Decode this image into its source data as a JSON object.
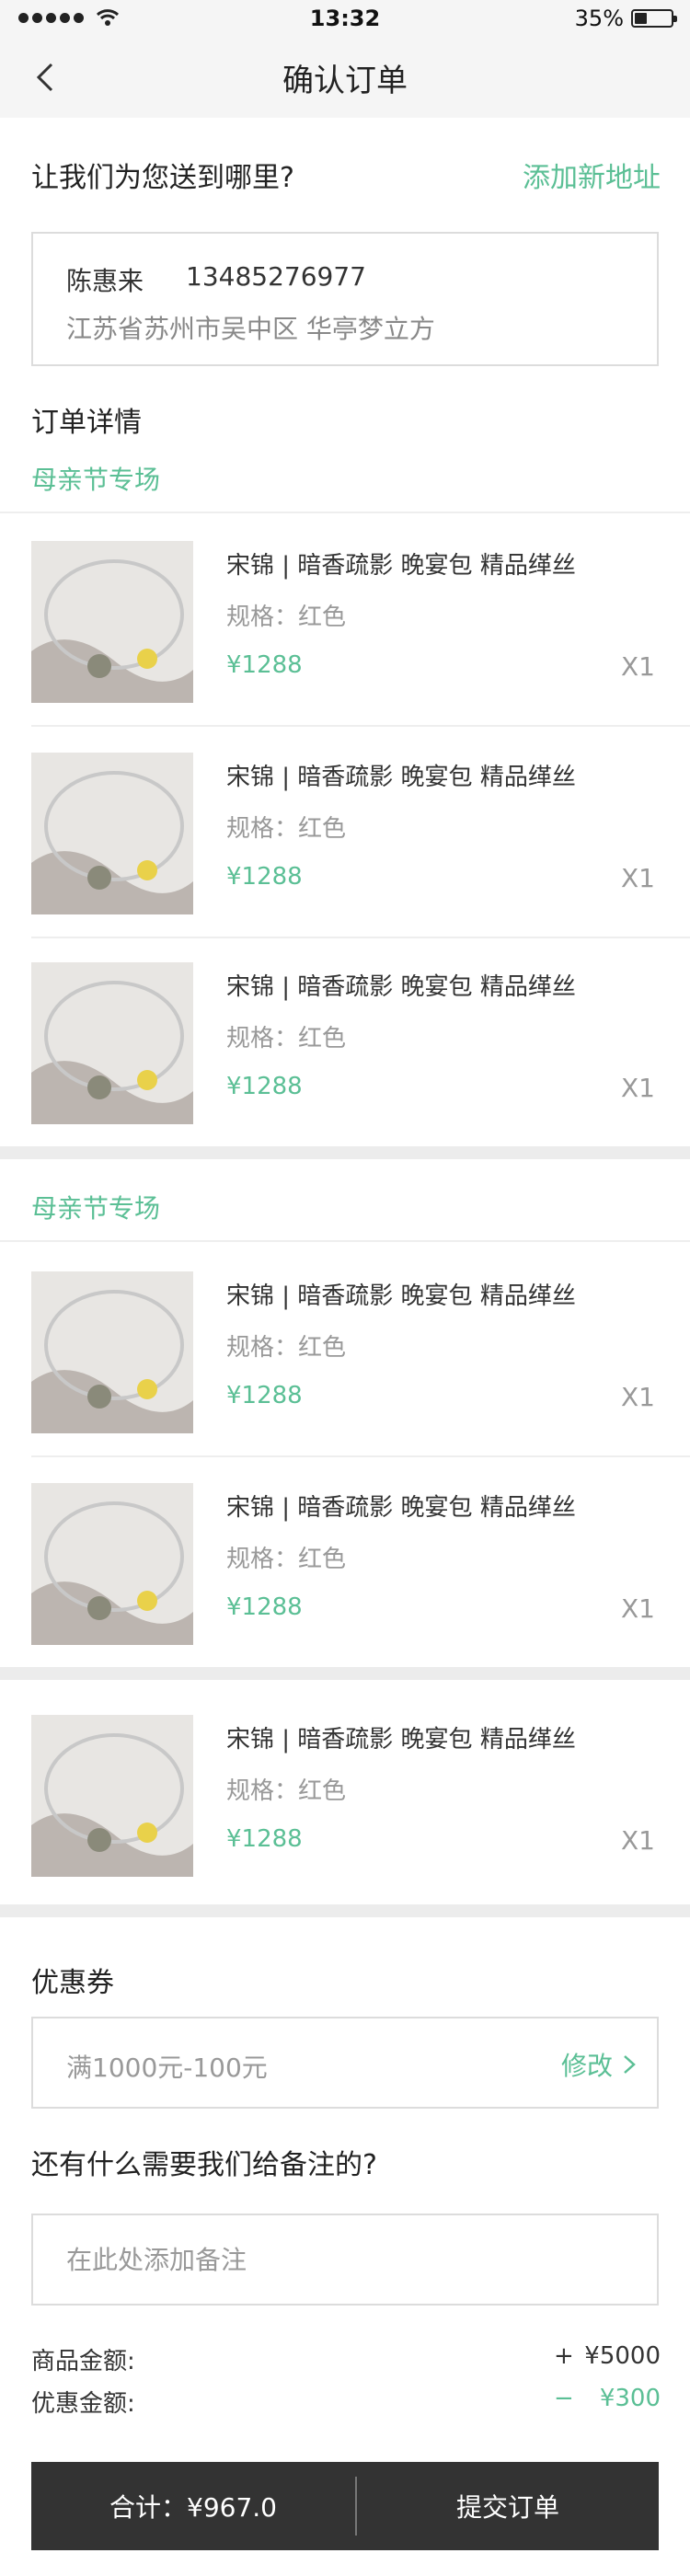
{
  "status_bar": {
    "time": "13:32",
    "battery_text": "35%",
    "battery_level": 0.35
  },
  "nav": {
    "title": "确认订单",
    "back_icon": "chevron-left-icon"
  },
  "delivery": {
    "title": "让我们为您送到哪里?",
    "add_address": "添加新地址",
    "name": "陈惠来",
    "phone": "13485276977",
    "address": "江苏省苏州市吴中区   华亭梦立方"
  },
  "order": {
    "title": "订单详情",
    "groups": [
      {
        "title": "母亲节专场",
        "items": [
          {
            "name": "宋锦 | 暗香疏影 晚宴包 精品缂丝",
            "spec": "规格：红色",
            "price": "¥1288",
            "qty": "X1"
          },
          {
            "name": "宋锦 | 暗香疏影 晚宴包 精品缂丝",
            "spec": "规格：红色",
            "price": "¥1288",
            "qty": "X1"
          },
          {
            "name": "宋锦 | 暗香疏影 晚宴包 精品缂丝",
            "spec": "规格：红色",
            "price": "¥1288",
            "qty": "X1"
          }
        ]
      },
      {
        "title": "母亲节专场",
        "items": [
          {
            "name": "宋锦 | 暗香疏影 晚宴包 精品缂丝",
            "spec": "规格：红色",
            "price": "¥1288",
            "qty": "X1"
          },
          {
            "name": "宋锦 | 暗香疏影 晚宴包 精品缂丝",
            "spec": "规格：红色",
            "price": "¥1288",
            "qty": "X1"
          }
        ]
      },
      {
        "title": "",
        "items": [
          {
            "name": "宋锦 | 暗香疏影 晚宴包 精品缂丝",
            "spec": "规格：红色",
            "price": "¥1288",
            "qty": "X1"
          }
        ]
      }
    ]
  },
  "coupon": {
    "title": "优惠券",
    "value": "满1000元-100元",
    "edit_label": "修改"
  },
  "remark": {
    "title": "还有什么需要我们给备注的?",
    "placeholder": "在此处添加备注"
  },
  "summary": {
    "goods_label": "商品金额:",
    "goods_sign": "+",
    "goods_value": "¥5000",
    "discount_label": "优惠金额:",
    "discount_sign": "−",
    "discount_value": "¥300"
  },
  "bottom": {
    "total": "合计：¥967.0",
    "submit": "提交订单"
  },
  "colors": {
    "accent": "#5bbf95",
    "bar": "#333333",
    "text": "#333333",
    "muted": "#999999"
  }
}
